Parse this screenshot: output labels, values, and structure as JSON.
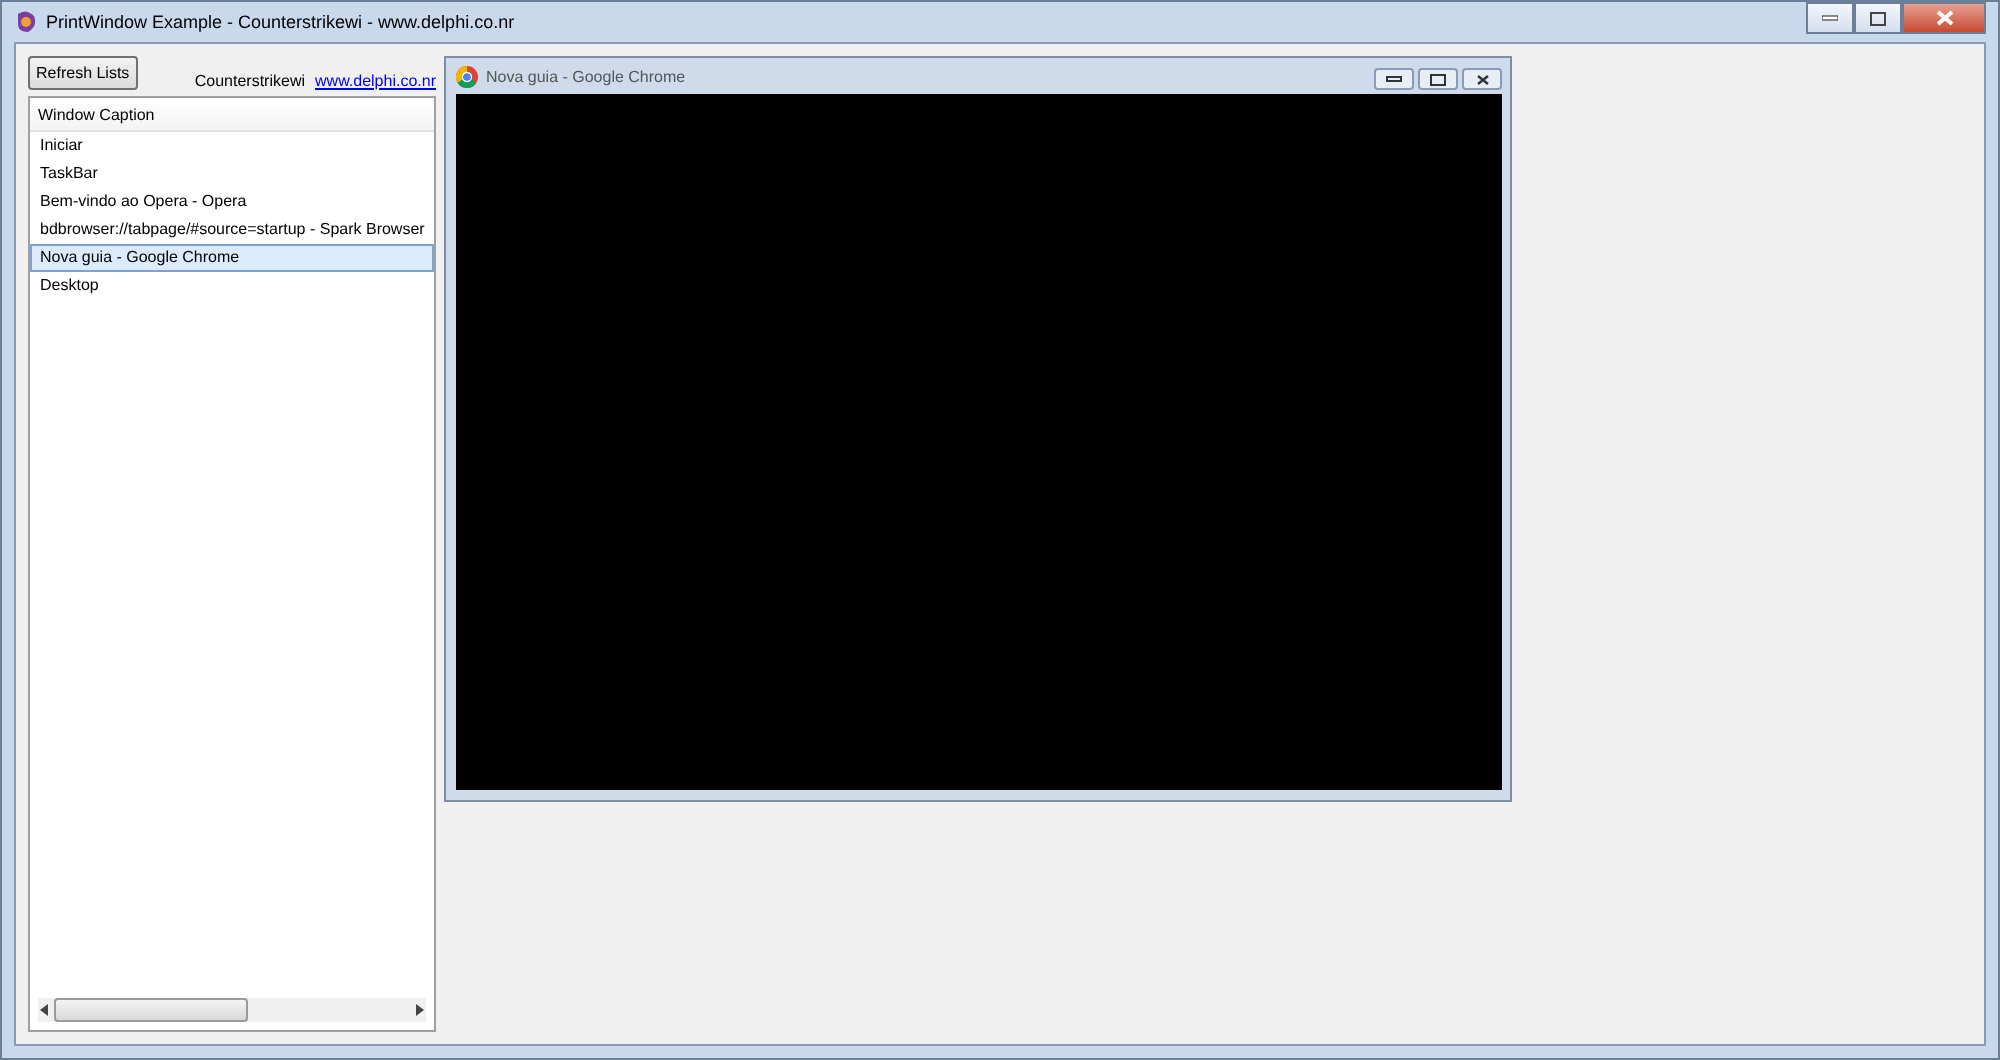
{
  "window": {
    "title": "PrintWindow Example - Counterstrikewi - www.delphi.co.nr"
  },
  "toolbar": {
    "refresh_button": "Refresh Lists",
    "author": "Counterstrikewi",
    "link": "www.delphi.co.nr"
  },
  "list": {
    "column": "Window Caption",
    "rows": [
      {
        "caption": "Iniciar",
        "selected": false
      },
      {
        "caption": "TaskBar",
        "selected": false
      },
      {
        "caption": "Bem-vindo ao Opera - Opera",
        "selected": false
      },
      {
        "caption": "bdbrowser://tabpage/#source=startup - Spark Browser",
        "selected": false
      },
      {
        "caption": "Nova guia - Google Chrome",
        "selected": true
      },
      {
        "caption": "Desktop",
        "selected": false
      }
    ]
  },
  "preview": {
    "title": "Nova guia - Google Chrome"
  }
}
